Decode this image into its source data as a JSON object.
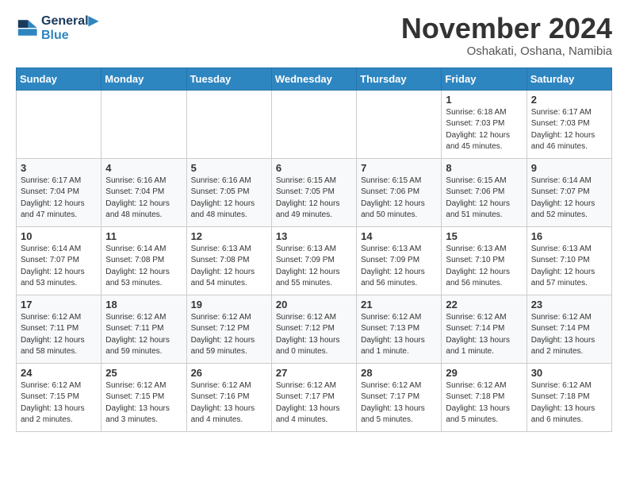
{
  "logo": {
    "line1": "General",
    "line2": "Blue"
  },
  "title": "November 2024",
  "subtitle": "Oshakati, Oshana, Namibia",
  "days_of_week": [
    "Sunday",
    "Monday",
    "Tuesday",
    "Wednesday",
    "Thursday",
    "Friday",
    "Saturday"
  ],
  "weeks": [
    [
      {
        "day": null,
        "info": null
      },
      {
        "day": null,
        "info": null
      },
      {
        "day": null,
        "info": null
      },
      {
        "day": null,
        "info": null
      },
      {
        "day": null,
        "info": null
      },
      {
        "day": "1",
        "info": "Sunrise: 6:18 AM\nSunset: 7:03 PM\nDaylight: 12 hours\nand 45 minutes."
      },
      {
        "day": "2",
        "info": "Sunrise: 6:17 AM\nSunset: 7:03 PM\nDaylight: 12 hours\nand 46 minutes."
      }
    ],
    [
      {
        "day": "3",
        "info": "Sunrise: 6:17 AM\nSunset: 7:04 PM\nDaylight: 12 hours\nand 47 minutes."
      },
      {
        "day": "4",
        "info": "Sunrise: 6:16 AM\nSunset: 7:04 PM\nDaylight: 12 hours\nand 48 minutes."
      },
      {
        "day": "5",
        "info": "Sunrise: 6:16 AM\nSunset: 7:05 PM\nDaylight: 12 hours\nand 48 minutes."
      },
      {
        "day": "6",
        "info": "Sunrise: 6:15 AM\nSunset: 7:05 PM\nDaylight: 12 hours\nand 49 minutes."
      },
      {
        "day": "7",
        "info": "Sunrise: 6:15 AM\nSunset: 7:06 PM\nDaylight: 12 hours\nand 50 minutes."
      },
      {
        "day": "8",
        "info": "Sunrise: 6:15 AM\nSunset: 7:06 PM\nDaylight: 12 hours\nand 51 minutes."
      },
      {
        "day": "9",
        "info": "Sunrise: 6:14 AM\nSunset: 7:07 PM\nDaylight: 12 hours\nand 52 minutes."
      }
    ],
    [
      {
        "day": "10",
        "info": "Sunrise: 6:14 AM\nSunset: 7:07 PM\nDaylight: 12 hours\nand 53 minutes."
      },
      {
        "day": "11",
        "info": "Sunrise: 6:14 AM\nSunset: 7:08 PM\nDaylight: 12 hours\nand 53 minutes."
      },
      {
        "day": "12",
        "info": "Sunrise: 6:13 AM\nSunset: 7:08 PM\nDaylight: 12 hours\nand 54 minutes."
      },
      {
        "day": "13",
        "info": "Sunrise: 6:13 AM\nSunset: 7:09 PM\nDaylight: 12 hours\nand 55 minutes."
      },
      {
        "day": "14",
        "info": "Sunrise: 6:13 AM\nSunset: 7:09 PM\nDaylight: 12 hours\nand 56 minutes."
      },
      {
        "day": "15",
        "info": "Sunrise: 6:13 AM\nSunset: 7:10 PM\nDaylight: 12 hours\nand 56 minutes."
      },
      {
        "day": "16",
        "info": "Sunrise: 6:13 AM\nSunset: 7:10 PM\nDaylight: 12 hours\nand 57 minutes."
      }
    ],
    [
      {
        "day": "17",
        "info": "Sunrise: 6:12 AM\nSunset: 7:11 PM\nDaylight: 12 hours\nand 58 minutes."
      },
      {
        "day": "18",
        "info": "Sunrise: 6:12 AM\nSunset: 7:11 PM\nDaylight: 12 hours\nand 59 minutes."
      },
      {
        "day": "19",
        "info": "Sunrise: 6:12 AM\nSunset: 7:12 PM\nDaylight: 12 hours\nand 59 minutes."
      },
      {
        "day": "20",
        "info": "Sunrise: 6:12 AM\nSunset: 7:12 PM\nDaylight: 13 hours\nand 0 minutes."
      },
      {
        "day": "21",
        "info": "Sunrise: 6:12 AM\nSunset: 7:13 PM\nDaylight: 13 hours\nand 1 minute."
      },
      {
        "day": "22",
        "info": "Sunrise: 6:12 AM\nSunset: 7:14 PM\nDaylight: 13 hours\nand 1 minute."
      },
      {
        "day": "23",
        "info": "Sunrise: 6:12 AM\nSunset: 7:14 PM\nDaylight: 13 hours\nand 2 minutes."
      }
    ],
    [
      {
        "day": "24",
        "info": "Sunrise: 6:12 AM\nSunset: 7:15 PM\nDaylight: 13 hours\nand 2 minutes."
      },
      {
        "day": "25",
        "info": "Sunrise: 6:12 AM\nSunset: 7:15 PM\nDaylight: 13 hours\nand 3 minutes."
      },
      {
        "day": "26",
        "info": "Sunrise: 6:12 AM\nSunset: 7:16 PM\nDaylight: 13 hours\nand 4 minutes."
      },
      {
        "day": "27",
        "info": "Sunrise: 6:12 AM\nSunset: 7:17 PM\nDaylight: 13 hours\nand 4 minutes."
      },
      {
        "day": "28",
        "info": "Sunrise: 6:12 AM\nSunset: 7:17 PM\nDaylight: 13 hours\nand 5 minutes."
      },
      {
        "day": "29",
        "info": "Sunrise: 6:12 AM\nSunset: 7:18 PM\nDaylight: 13 hours\nand 5 minutes."
      },
      {
        "day": "30",
        "info": "Sunrise: 6:12 AM\nSunset: 7:18 PM\nDaylight: 13 hours\nand 6 minutes."
      }
    ]
  ]
}
